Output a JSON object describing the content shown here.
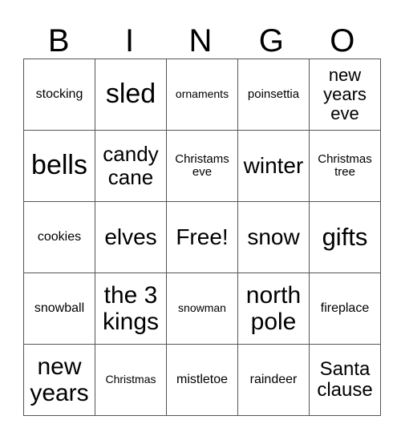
{
  "header": {
    "letters": [
      "B",
      "I",
      "N",
      "G",
      "O"
    ]
  },
  "grid": {
    "rows": [
      [
        "stocking",
        "sled",
        "ornaments",
        "poinsettia",
        "new years eve"
      ],
      [
        "bells",
        "candy cane",
        "Christams eve",
        "winter",
        "Christmas tree"
      ],
      [
        "cookies",
        "elves",
        "Free!",
        "snow",
        "gifts"
      ],
      [
        "snowball",
        "the 3 kings",
        "snowman",
        "north pole",
        "fireplace"
      ],
      [
        "new years",
        "Christmas",
        "mistletoe",
        "raindeer",
        "Santa clause"
      ]
    ]
  }
}
